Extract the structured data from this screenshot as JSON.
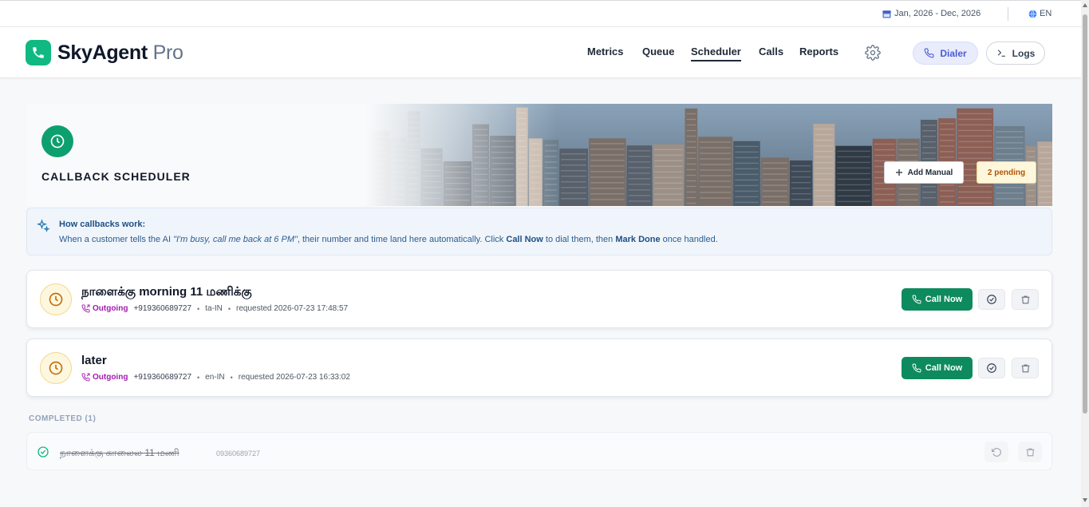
{
  "topbar": {
    "date_range": "Jan, 2026 - Dec, 2026",
    "language": "EN"
  },
  "brand": {
    "name": "SkyAgent",
    "suffix": "Pro"
  },
  "nav": {
    "items": [
      {
        "label": "Metrics",
        "active": false
      },
      {
        "label": "Queue",
        "active": false
      },
      {
        "label": "Scheduler",
        "active": true
      },
      {
        "label": "Calls",
        "active": false
      },
      {
        "label": "Reports",
        "active": false
      }
    ],
    "dialer_label": "Dialer",
    "logs_label": "Logs"
  },
  "hero": {
    "title": "CALLBACK SCHEDULER",
    "add_manual_label": "Add Manual",
    "pending_label": "2 pending"
  },
  "info": {
    "heading": "How callbacks work:",
    "text_1": "When a customer tells the AI ",
    "quote": "\"I'm busy, call me back at 6 PM\"",
    "text_2": ", their number and time land here automatically. Click ",
    "call_now": "Call Now",
    "text_3": " to dial them, then ",
    "mark_done": "Mark Done",
    "text_4": " once handled."
  },
  "callbacks": [
    {
      "title": "நாளைக்கு morning 11 மணிக்கு",
      "direction": "Outgoing",
      "number": "+919360689727",
      "locale": "ta-IN",
      "requested": "requested 2026-07-23 17:48:57",
      "call_label": "Call Now"
    },
    {
      "title": "later",
      "direction": "Outgoing",
      "number": "+919360689727",
      "locale": "en-IN",
      "requested": "requested 2026-07-23 16:33:02",
      "call_label": "Call Now"
    }
  ],
  "completed": {
    "label": "COMPLETED (1)",
    "items": [
      {
        "title": "நாளைக்கு காலைல 11 மணி",
        "number": "09360689727"
      }
    ]
  },
  "colors": {
    "brand_green": "#10b981",
    "call_green": "#0e8a5f",
    "outgoing_purple": "#a21caf",
    "pending_amber": "#b45309",
    "dialer_indigo": "#4c5bd4"
  },
  "icons": [
    "calendar-icon",
    "globe-icon",
    "phone-icon",
    "gear-icon",
    "terminal-icon",
    "clock-icon",
    "plus-icon",
    "sparkle-icon",
    "outgoing-call-icon",
    "check-circle-icon",
    "trash-icon",
    "undo-icon"
  ]
}
